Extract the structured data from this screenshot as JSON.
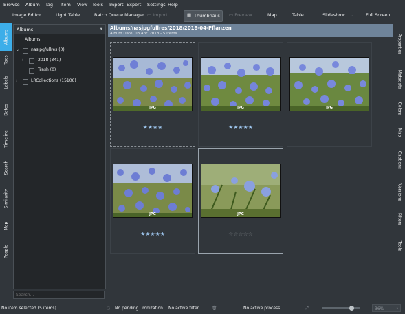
{
  "menu": [
    "Browse",
    "Album",
    "Tag",
    "Item",
    "View",
    "Tools",
    "Import",
    "Export",
    "Settings",
    "Help"
  ],
  "toolbar": {
    "image_editor": "Image Editor",
    "light_table": "Light Table",
    "batch_queue": "Batch Queue Manager",
    "import": "Import",
    "thumbnails": "Thumbnails",
    "preview": "Preview",
    "map": "Map",
    "table": "Table",
    "slideshow": "Slideshow",
    "full_screen": "Full Screen"
  },
  "left_tabs": [
    "Albums",
    "Tags",
    "Labels",
    "Dates",
    "Timeline",
    "Search",
    "Similarity",
    "Map",
    "People"
  ],
  "right_tabs": [
    "Properties",
    "Metadata",
    "Colors",
    "Map",
    "Captions",
    "Versions",
    "Filters",
    "Tools"
  ],
  "album_panel": {
    "header": "Albums",
    "tree": [
      {
        "label": "Albums"
      },
      {
        "label": "nasjpgfullres (0)"
      },
      {
        "label": "2018 (341)"
      },
      {
        "label": "Trash (0)"
      },
      {
        "label": "LRCollections (15106)"
      }
    ],
    "search_placeholder": "Search..."
  },
  "main": {
    "path": "Albums/nasjpgfullres/2018/2018-04-Pflanzen",
    "subtitle": "Album Date: 08 Apr. 2018 - 5 Items"
  },
  "thumbnails": [
    {
      "type": "JPG",
      "rating": 4,
      "stars": "★★★★"
    },
    {
      "type": "JPG",
      "rating": 5,
      "stars": "★★★★★"
    },
    {
      "type": "JPG",
      "rating": 0,
      "stars": ""
    },
    {
      "type": "JPG",
      "rating": 5,
      "stars": "★★★★★"
    },
    {
      "type": "JPG",
      "rating": 0,
      "stars": "☆☆☆☆☆"
    }
  ],
  "status": {
    "selection": "No item selected (5 items)",
    "pending": "No pending...ronization",
    "filter": "No active filter",
    "process": "No active process",
    "zoom": "36%"
  },
  "colors": {
    "accent": "#3daee9",
    "header": "#6f849a",
    "star": "#9ec6ee"
  }
}
